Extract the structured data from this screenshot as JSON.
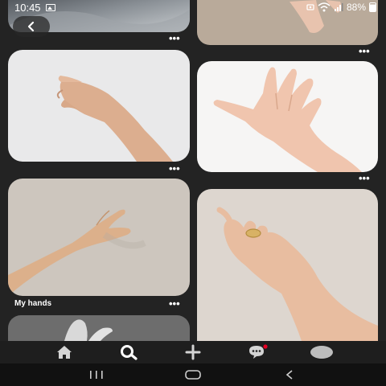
{
  "status_bar": {
    "time": "10:45",
    "battery": "88%",
    "icons": [
      "image-icon",
      "photo-icon",
      "wifi-icon",
      "signal-icon",
      "battery-icon"
    ]
  },
  "header": {
    "back_icon": "chevron-left-icon"
  },
  "pins": [
    {
      "id": "pin-top-left",
      "title": "",
      "more": "•••"
    },
    {
      "id": "pin-top-right",
      "title": "",
      "more": "•••"
    },
    {
      "id": "pin-hand-relaxed",
      "title": "",
      "more": "•••"
    },
    {
      "id": "pin-hand-spread",
      "title": "",
      "more": "•••"
    },
    {
      "id": "pin-arm-reaching",
      "title": "My hands",
      "more": "•••"
    },
    {
      "id": "pin-hand-ring",
      "title": "",
      "more": ""
    },
    {
      "id": "pin-hand-bottom",
      "title": "",
      "more": ""
    }
  ],
  "bottom_nav": {
    "items": [
      "home-icon",
      "search-icon",
      "add-icon",
      "messages-icon",
      "profile-avatar"
    ],
    "active": "search-icon",
    "notification_color": "#e60023"
  },
  "system_nav": {
    "items": [
      "recent-apps-button",
      "home-button",
      "back-button"
    ]
  }
}
